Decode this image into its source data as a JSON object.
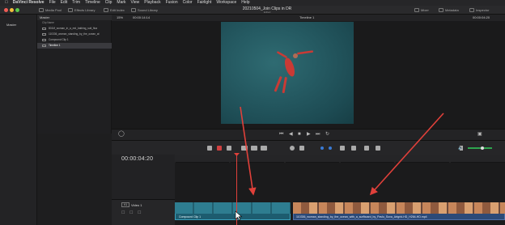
{
  "menubar": {
    "app_name": "DaVinci Resolve",
    "items": [
      "File",
      "Edit",
      "Trim",
      "Timeline",
      "Clip",
      "Mark",
      "View",
      "Playback",
      "Fusion",
      "Color",
      "Fairlight",
      "Workspace",
      "Help"
    ]
  },
  "toolbar": {
    "media_pool": "Media Pool",
    "effects_library": "Effects Library",
    "edit_index": "Edit Index",
    "sound_library": "Sound Library",
    "project_title": "20210504_Join Clips in DR",
    "project_sub": "Edited",
    "mixer": "Mixer",
    "metadata": "Metadata",
    "inspector": "Inspector"
  },
  "left_panel": {
    "master": "Master"
  },
  "media_pool": {
    "header": "Master",
    "column": "Clip Name",
    "clips": [
      "801M_woman_in_a_red_bathing_suit_floa",
      "110336_woman_standing_by_the_ocean_at",
      "Compound Clip 1",
      "Timeline 1"
    ]
  },
  "viewer": {
    "zoom": "15%",
    "source_tc": "00:00:14:14",
    "timeline_name": "Timeline 1",
    "record_tc": "00:00:04:20"
  },
  "timeline": {
    "timecode": "00:00:04:20",
    "track_badge": "V1",
    "track_name": "Video 1",
    "clip1_name": "Compound Clip 1",
    "clip2_name": "110336_woman_standing_by_the_ocean_with_a_surfboard_by_Pavlo_Sova_Artgrid-HD_H264-HD.mp4"
  },
  "colors": {
    "accent_red": "#e0403a",
    "clip_teal": "#1d5c6f",
    "clip_blue": "#2c4a78",
    "bg": "#1e1e1f"
  }
}
